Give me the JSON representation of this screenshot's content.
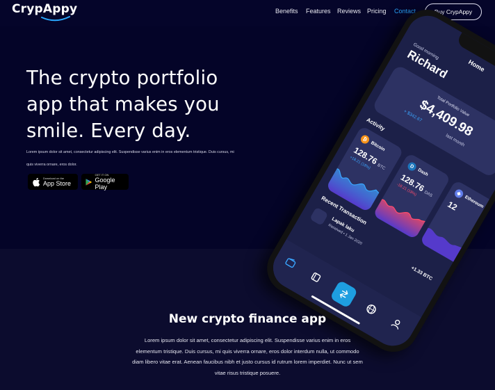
{
  "nav": {
    "logo": "CrypAppy",
    "links": [
      "Benefits",
      "Features",
      "Reviews",
      "Pricing",
      "Contact"
    ],
    "active_link": "Contact",
    "cta": "Buy CrypAppy"
  },
  "hero": {
    "title": "The crypto portfolio app that makes you smile. Every day.",
    "description": "Lorem ipsum dolor sit amet, consectetur adipiscing elit. Suspendisse varius enim in eros elementum tristique. Duis cursus, mi quis viverra ornare, eros dolor.",
    "app_store": {
      "small": "Download on the",
      "big": "App Store"
    },
    "google_play": {
      "small": "GET IT ON",
      "big": "Google Play"
    }
  },
  "phone": {
    "title": "Home",
    "greeting": "Good morning",
    "user_name": "Richard",
    "total_label": "Total Portfolio Value",
    "total_value": "$4,409.98",
    "total_change": "+ $342.67",
    "total_period": "last month",
    "activity_label": "Activity",
    "coins": [
      {
        "name": "Bitcoin",
        "amount": "128.76",
        "unit": "BTC",
        "change": "+18.21 (18%)",
        "color": "#f7931a",
        "change_color": "#3aa6ff"
      },
      {
        "name": "Dash",
        "amount": "128.76",
        "unit": "DAS",
        "change": "-18.21 (18%)",
        "color": "#1c75bc",
        "change_color": "#ff4d6d"
      },
      {
        "name": "Ethereum",
        "amount": "12",
        "unit": "",
        "change": "",
        "color": "#627eea",
        "change_color": "#ff4d6d"
      }
    ],
    "recent_label": "Recent Transaction",
    "transaction": {
      "name": "Lapak laku",
      "date": "Received • 1 Jan 2020",
      "amount": "+1.33 BTC"
    }
  },
  "section2": {
    "title": "New crypto finance app",
    "description": "Lorem ipsum dolor sit amet, consectetur adipiscing elit. Suspendisse varius enim in eros elementum tristique. Duis cursus, mi quis viverra ornare, eros dolor interdum nulla, ut commodo diam libero vitae erat. Aenean faucibus nibh et justo cursus id rutrum lorem imperdiet. Nunc ut sem vitae risus tristique posuere."
  },
  "colors": {
    "accent": "#2aa8ff",
    "hero_bg": "#040428",
    "section_bg": "#0c0c2e",
    "card_bg": "#2d3263"
  }
}
